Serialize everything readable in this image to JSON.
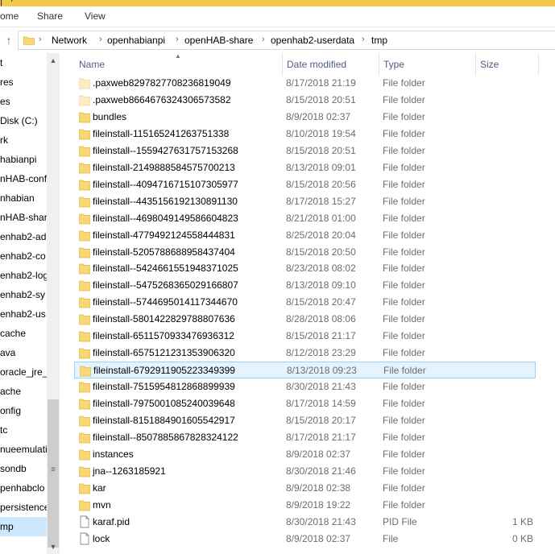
{
  "window": {
    "title": "tmp",
    "title_prefix": "ome"
  },
  "ribbon": {
    "tabs": [
      "ome",
      "Share",
      "View"
    ]
  },
  "address": {
    "crumbs": [
      "Network",
      "openhabianpi",
      "openHAB-share",
      "openhab2-userdata",
      "tmp"
    ]
  },
  "nav": {
    "items": [
      "t",
      "res",
      "es",
      "Disk (C:)",
      "rk",
      "habianpi",
      "nHAB-conf",
      "nhabian",
      "nHAB-shar",
      "enhab2-ad",
      "enhab2-co",
      "enhab2-log",
      "enhab2-sy",
      "enhab2-us",
      "cache",
      "ava",
      "oracle_jre_",
      "ache",
      "onfig",
      "tc",
      "nueemulati",
      "sondb",
      "penhabclo",
      "persistence",
      "mp"
    ],
    "selected_index": 24
  },
  "columns": {
    "name": "Name",
    "date": "Date modified",
    "type": "Type",
    "size": "Size"
  },
  "files": [
    {
      "name": ".paxweb8297827708236819049",
      "date": "8/17/2018 21:19",
      "type": "File folder",
      "size": "",
      "icon": "folder-hidden-icon"
    },
    {
      "name": ".paxweb8664676324306573582",
      "date": "8/15/2018 20:51",
      "type": "File folder",
      "size": "",
      "icon": "folder-hidden-icon"
    },
    {
      "name": "bundles",
      "date": "8/9/2018 02:37",
      "type": "File folder",
      "size": "",
      "icon": "folder-icon"
    },
    {
      "name": "fileinstall-115165241263751338",
      "date": "8/10/2018 19:54",
      "type": "File folder",
      "size": "",
      "icon": "folder-icon"
    },
    {
      "name": "fileinstall--1559427631757153268",
      "date": "8/15/2018 20:51",
      "type": "File folder",
      "size": "",
      "icon": "folder-icon"
    },
    {
      "name": "fileinstall-2149888584575700213",
      "date": "8/13/2018 09:01",
      "type": "File folder",
      "size": "",
      "icon": "folder-icon"
    },
    {
      "name": "fileinstall--4094716715107305977",
      "date": "8/15/2018 20:56",
      "type": "File folder",
      "size": "",
      "icon": "folder-icon"
    },
    {
      "name": "fileinstall--4435156192130891130",
      "date": "8/17/2018 15:27",
      "type": "File folder",
      "size": "",
      "icon": "folder-icon"
    },
    {
      "name": "fileinstall--4698049149586604823",
      "date": "8/21/2018 01:00",
      "type": "File folder",
      "size": "",
      "icon": "folder-icon"
    },
    {
      "name": "fileinstall-4779492124558444831",
      "date": "8/25/2018 20:04",
      "type": "File folder",
      "size": "",
      "icon": "folder-icon"
    },
    {
      "name": "fileinstall-5205788688958437404",
      "date": "8/15/2018 20:50",
      "type": "File folder",
      "size": "",
      "icon": "folder-icon"
    },
    {
      "name": "fileinstall--5424661551948371025",
      "date": "8/23/2018 08:02",
      "type": "File folder",
      "size": "",
      "icon": "folder-icon"
    },
    {
      "name": "fileinstall--5475268365029166807",
      "date": "8/13/2018 09:10",
      "type": "File folder",
      "size": "",
      "icon": "folder-icon"
    },
    {
      "name": "fileinstall--5744695014117344670",
      "date": "8/15/2018 20:47",
      "type": "File folder",
      "size": "",
      "icon": "folder-icon"
    },
    {
      "name": "fileinstall-5801422829788807636",
      "date": "8/28/2018 08:06",
      "type": "File folder",
      "size": "",
      "icon": "folder-icon"
    },
    {
      "name": "fileinstall-6511570933476936312",
      "date": "8/15/2018 21:17",
      "type": "File folder",
      "size": "",
      "icon": "folder-icon"
    },
    {
      "name": "fileinstall-6575121231353906320",
      "date": "8/12/2018 23:29",
      "type": "File folder",
      "size": "",
      "icon": "folder-icon"
    },
    {
      "name": "fileinstall-6792911905223349399",
      "date": "8/13/2018 09:23",
      "type": "File folder",
      "size": "",
      "icon": "folder-icon"
    },
    {
      "name": "fileinstall-7515954812868899939",
      "date": "8/30/2018 21:43",
      "type": "File folder",
      "size": "",
      "icon": "folder-icon"
    },
    {
      "name": "fileinstall-7975001085240039648",
      "date": "8/17/2018 14:59",
      "type": "File folder",
      "size": "",
      "icon": "folder-icon"
    },
    {
      "name": "fileinstall-8151884901605542917",
      "date": "8/15/2018 20:17",
      "type": "File folder",
      "size": "",
      "icon": "folder-icon"
    },
    {
      "name": "fileinstall--8507885867828324122",
      "date": "8/17/2018 21:17",
      "type": "File folder",
      "size": "",
      "icon": "folder-icon"
    },
    {
      "name": "instances",
      "date": "8/9/2018 02:37",
      "type": "File folder",
      "size": "",
      "icon": "folder-icon"
    },
    {
      "name": "jna--1263185921",
      "date": "8/30/2018 21:46",
      "type": "File folder",
      "size": "",
      "icon": "folder-icon"
    },
    {
      "name": "kar",
      "date": "8/9/2018 02:38",
      "type": "File folder",
      "size": "",
      "icon": "folder-icon"
    },
    {
      "name": "mvn",
      "date": "8/9/2018 19:22",
      "type": "File folder",
      "size": "",
      "icon": "folder-icon"
    },
    {
      "name": "karaf.pid",
      "date": "8/30/2018 21:43",
      "type": "PID File",
      "size": "1 KB",
      "icon": "file-icon"
    },
    {
      "name": "lock",
      "date": "8/9/2018 02:37",
      "type": "File",
      "size": "0 KB",
      "icon": "file-icon"
    }
  ],
  "selected_file_index": 17,
  "colors": {
    "folder": "#f8d775",
    "folder_edge": "#e0b84a",
    "selection_bg": "#e5f3ff",
    "selection_border": "#99d1ff",
    "nav_selected": "#cce8ff"
  }
}
